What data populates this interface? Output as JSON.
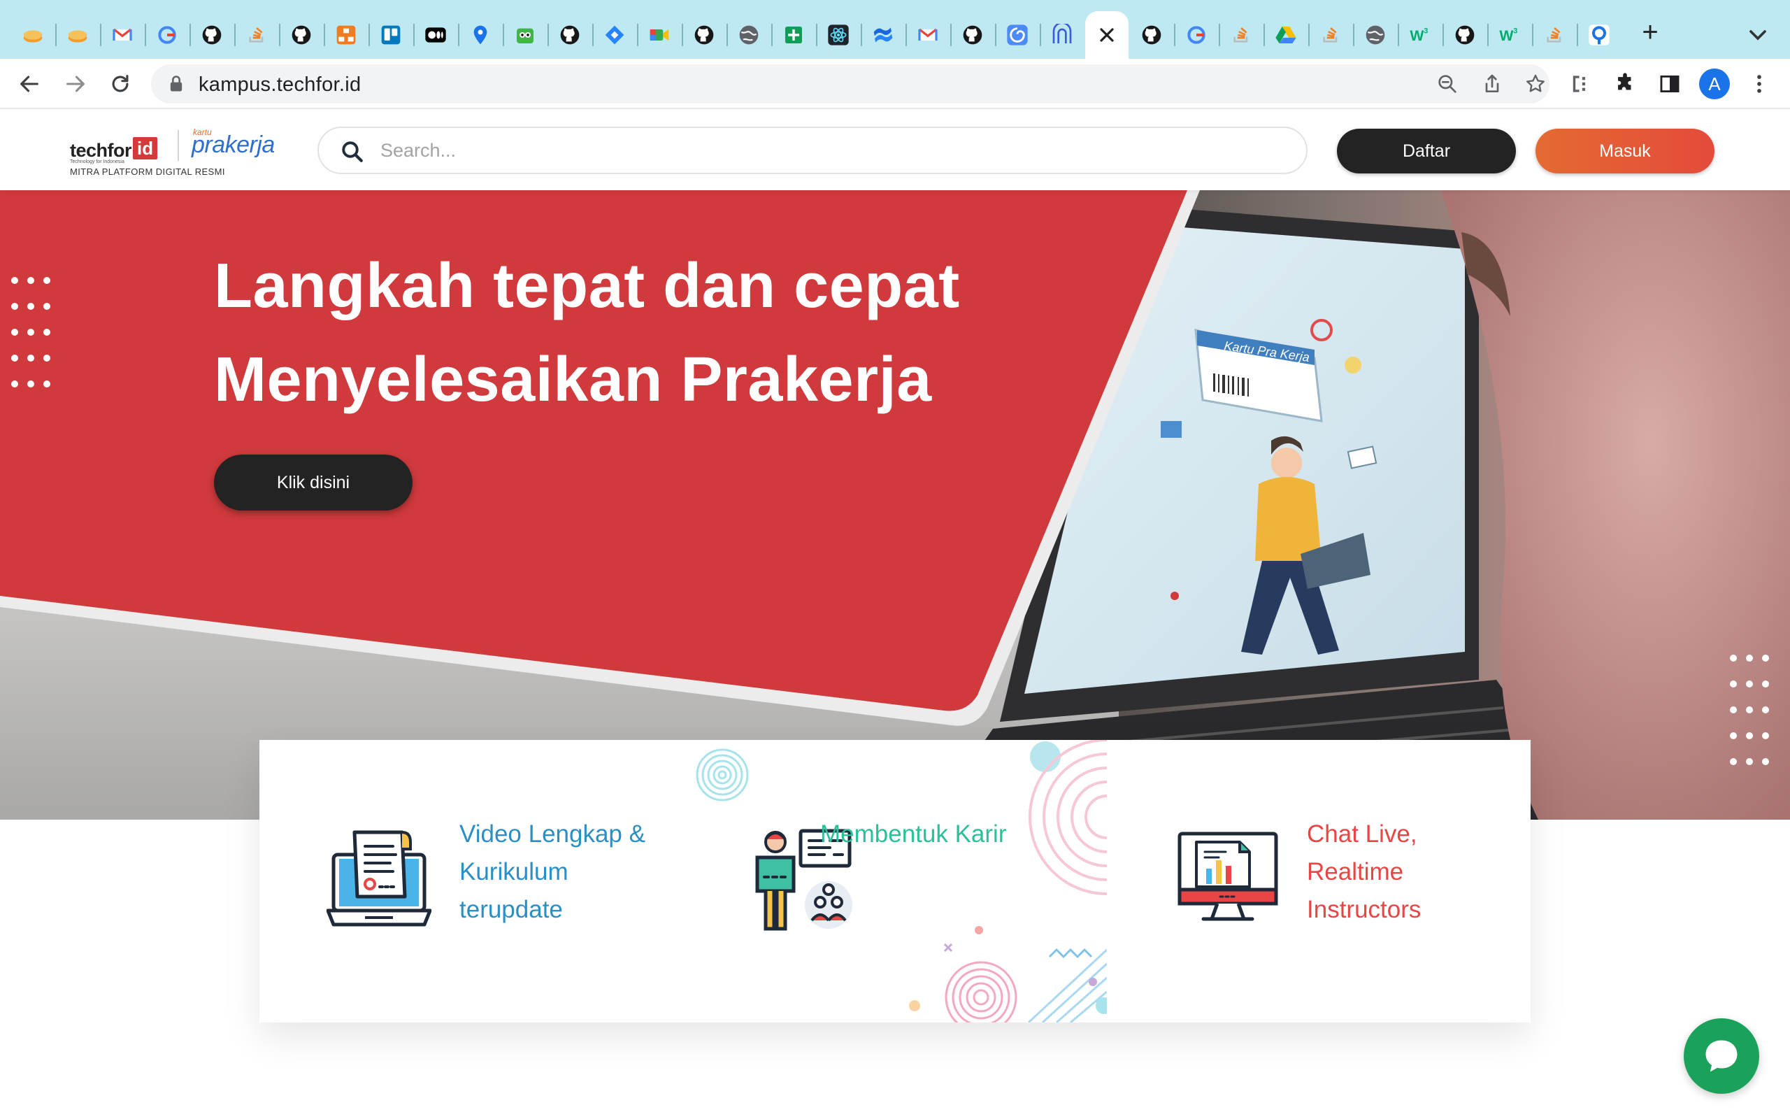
{
  "browser": {
    "url": "kampus.techfor.id",
    "tabs": [
      {
        "icon": "cake-icon",
        "color": "#f39c2d"
      },
      {
        "icon": "cake-icon",
        "color": "#f39c2d"
      },
      {
        "icon": "gmail-icon",
        "color": "#ea4335"
      },
      {
        "icon": "google-icon",
        "color": "#4285f4"
      },
      {
        "icon": "github-icon",
        "color": "#181717"
      },
      {
        "icon": "stack-icon",
        "color": "#f48024"
      },
      {
        "icon": "github-icon",
        "color": "#181717"
      },
      {
        "icon": "diagram-icon",
        "color": "#f07c22"
      },
      {
        "icon": "trello-icon",
        "color": "#0079bf"
      },
      {
        "icon": "medium-icon",
        "color": "#000000"
      },
      {
        "icon": "maps-pin-icon",
        "color": "#1a73e8"
      },
      {
        "icon": "tokopedia-icon",
        "color": "#42b549"
      },
      {
        "icon": "github-icon",
        "color": "#181717"
      },
      {
        "icon": "jira-icon",
        "color": "#2684ff"
      },
      {
        "icon": "meet-icon",
        "color": "#00897b"
      },
      {
        "icon": "github-icon",
        "color": "#181717"
      },
      {
        "icon": "globe-icon",
        "color": "#5f6368"
      },
      {
        "icon": "sheets-icon",
        "color": "#0f9d58"
      },
      {
        "icon": "react-icon",
        "color": "#20232a"
      },
      {
        "icon": "confluence-icon",
        "color": "#2684ff"
      },
      {
        "icon": "gmail-icon",
        "color": "#ea4335"
      },
      {
        "icon": "github-icon",
        "color": "#181717"
      },
      {
        "icon": "swirl-icon",
        "color": "#4c8bf5"
      },
      {
        "icon": "arch-icon",
        "color": "#3b5bdb"
      },
      {
        "icon": "close-icon",
        "color": "#202124",
        "active": true
      },
      {
        "icon": "github-icon",
        "color": "#181717"
      },
      {
        "icon": "google-icon",
        "color": "#4285f4"
      },
      {
        "icon": "stack-icon",
        "color": "#f48024"
      },
      {
        "icon": "drive-icon",
        "color": "#0f9d58"
      },
      {
        "icon": "stack-icon",
        "color": "#f48024"
      },
      {
        "icon": "globe-icon",
        "color": "#5f6368"
      },
      {
        "icon": "w3-icon",
        "color": "#04aa6d"
      },
      {
        "icon": "github-icon",
        "color": "#181717"
      },
      {
        "icon": "w3-icon",
        "color": "#04aa6d"
      },
      {
        "icon": "stack-icon",
        "color": "#f48024"
      },
      {
        "icon": "pinpoint-icon",
        "color": "#1a73e8"
      }
    ],
    "profile_initial": "A"
  },
  "header": {
    "logo": {
      "brand": "techfor",
      "brand_id": "id",
      "brand_sub": "Technology for Indonesia",
      "partner_small": "kartu",
      "partner": "prakerja",
      "tagline": "MITRA PLATFORM DIGITAL RESMI"
    },
    "search_placeholder": "Search...",
    "register_label": "Daftar",
    "login_label": "Masuk",
    "login_gradient": [
      "#e46a32",
      "#e34b3a"
    ]
  },
  "hero": {
    "title_line1": "Langkah tepat dan cepat",
    "title_line2": "Menyelesaikan Prakerja",
    "cta_label": "Klik disini",
    "accent_color": "#d13a3c",
    "laptop_screen_label": "Kartu Pra Kerja"
  },
  "features": [
    {
      "lines": [
        "Video Lengkap &",
        "Kurikulum",
        "terupdate"
      ],
      "color": "#2b8fc6",
      "icon": "laptop-document-icon"
    },
    {
      "lines": [
        "Membentuk Karir"
      ],
      "color": "#2bbf9a",
      "icon": "career-presenter-icon"
    },
    {
      "lines": [
        "Chat Live,",
        "Realtime",
        "Instructors"
      ],
      "color": "#e84545",
      "icon": "monitor-chart-icon"
    }
  ],
  "chat": {
    "icon": "chat-bubble-icon",
    "color": "#1aa15a"
  }
}
